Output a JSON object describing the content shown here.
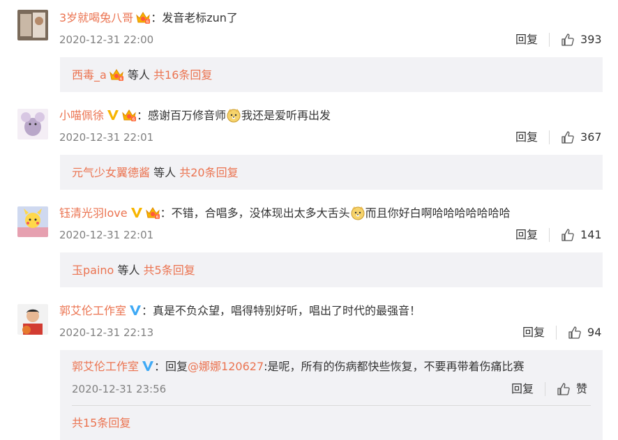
{
  "comments": [
    {
      "user": "3岁就喝兔八哥",
      "text": "发音老标zun了",
      "time": "2020-12-31 22:00",
      "reply_label": "回复",
      "likes": "393",
      "sub": {
        "users": "西毒_a",
        "others": "等人",
        "total": "共16条回复"
      }
    },
    {
      "user": "小喵佩徐",
      "text_before": "感谢百万修音师",
      "text_after": "我还是爱听再出发",
      "time": "2020-12-31 22:01",
      "reply_label": "回复",
      "likes": "367",
      "sub": {
        "users": "元气少女翼德酱",
        "others": "等人",
        "total": "共20条回复"
      }
    },
    {
      "user": "钰清光羽love",
      "text_before": "不错，合唱多，没体现出太多大舌头",
      "text_after": "而且你好白啊哈哈哈哈哈哈哈",
      "time": "2020-12-31 22:01",
      "reply_label": "回复",
      "likes": "141",
      "sub": {
        "users": "玉paino",
        "others": "等人",
        "total": "共5条回复"
      }
    },
    {
      "user": "郭艾伦工作室",
      "text": "真是不负众望，唱得特别好听，唱出了时代的最强音！",
      "time": "2020-12-31 22:13",
      "reply_label": "回复",
      "likes": "94",
      "sub_reply": {
        "user": "郭艾伦工作室",
        "reply_word": "回复",
        "mention": "@娜娜120627",
        "text": ":是呢，所有的伤病都快些恢复，不要再带着伤痛比赛",
        "time": "2020-12-31 23:56",
        "reply_label": "回复",
        "like_label": "赞"
      },
      "sub": {
        "total": "共15条回复"
      }
    }
  ],
  "colon": "：",
  "colors": {
    "accent": "#eb7350",
    "text": "#333333",
    "muted": "#808080",
    "subbg": "#f2f2f5",
    "vip": "#f7b500",
    "verified": "#3ea9f5"
  }
}
